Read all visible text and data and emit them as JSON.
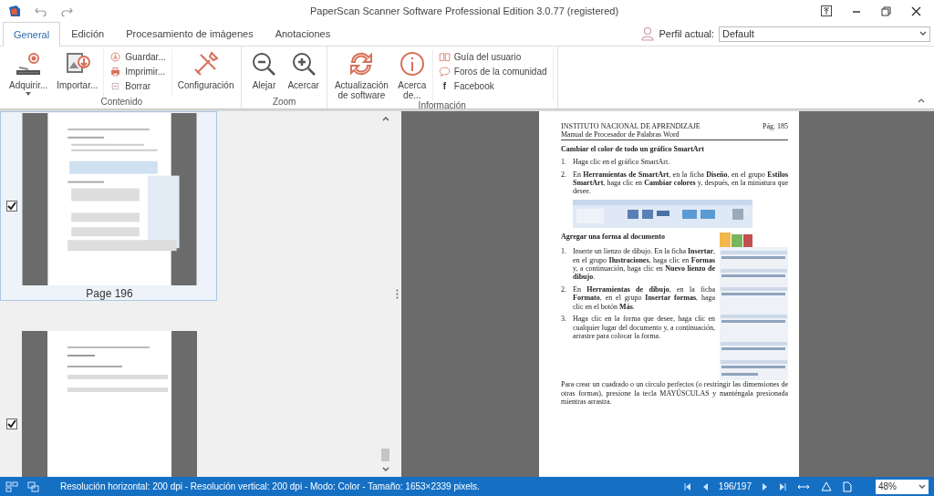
{
  "window": {
    "title": "PaperScan Scanner Software Professional Edition 3.0.77 (registered)"
  },
  "tabs": [
    {
      "label": "General",
      "selected": true
    },
    {
      "label": "Edición",
      "selected": false
    },
    {
      "label": "Procesamiento de imágenes",
      "selected": false
    },
    {
      "label": "Anotaciones",
      "selected": false
    }
  ],
  "profile": {
    "label": "Perfil actual:",
    "value": "Default"
  },
  "ribbon": [
    {
      "label": "Contenido",
      "controls": [
        {
          "kind": "large",
          "label": "Adquirir...",
          "has_menu": true
        },
        {
          "kind": "large",
          "label": "Importar...",
          "has_menu": false
        },
        {
          "kind": "stack",
          "items": [
            {
              "label": "Guardar..."
            },
            {
              "label": "Imprimir..."
            },
            {
              "label": "Borrar"
            }
          ]
        },
        {
          "kind": "large",
          "label": "Configuración",
          "has_menu": false
        }
      ]
    },
    {
      "label": "Zoom",
      "controls": [
        {
          "kind": "large",
          "label": "Alejar",
          "has_menu": false
        },
        {
          "kind": "large",
          "label": "Acercar",
          "has_menu": false
        }
      ]
    },
    {
      "label": "Información",
      "controls": [
        {
          "kind": "large",
          "label": "Actualización\nde software",
          "has_menu": false
        },
        {
          "kind": "large",
          "label": "Acerca\nde...",
          "has_menu": false
        },
        {
          "kind": "stack",
          "items": [
            {
              "label": "Guía del usuario"
            },
            {
              "label": "Foros de la comunidad"
            },
            {
              "label": "Facebook",
              "glyph": "f"
            }
          ]
        }
      ]
    }
  ],
  "thumbnails": [
    {
      "label": "Page 196",
      "checked": true,
      "selected": true
    },
    {
      "checked": true,
      "selected": false
    }
  ],
  "document": {
    "header_left": [
      "INSTITUTO NACIONAL DE APRENDIZAJE",
      "Manual de Procesador de Palabras Word"
    ],
    "header_right": "Pág.  185",
    "sections": [
      {
        "heading": "Cambiar el color de todo un gráfico SmartArt",
        "steps": [
          {
            "number": "1.",
            "text": "Haga clic en el gráfico SmartArt."
          },
          {
            "number": "2.",
            "text": "En **Herramientas de SmartArt**, en la ficha **Diseño**, en el grupo **Estilos SmartArt**, haga clic en **Cambiar colores** y, después, en la miniatura que desee."
          }
        ]
      },
      {
        "heading": "Agregar una forma al documento",
        "steps": [
          {
            "number": "1.",
            "text": "Inserte un lienzo de dibujo. En la ficha **Insertar**, en el grupo **Ilustraciones**, haga clic en **Formas** y, a continuación, haga clic en **Nuevo lienzo de dibujo**."
          },
          {
            "number": "2.",
            "text": "En **Herramientas de dibujo**, en la ficha **Formato**, en el grupo **Insertar formas**, haga clic en el botón **Más**."
          },
          {
            "number": "3.",
            "text": "Haga clic en la forma que desee, haga clic en cualquier lugar del documento y, a continuación, arrastre para colocar la forma."
          }
        ],
        "note": "Para crear un cuadrado o un círculo perfectos (o restringir las dimensiones de otras formas), presione la tecla MAYÚSCULAS y manténgala presionada mientras arrastra."
      }
    ]
  },
  "status_bar": {
    "info": "Resolución horizontal:  200 dpi - Resolución vertical:  200 dpi - Modo: Color - Tamaño: 1653×2339 pixels.",
    "page": "196/197",
    "zoom": "48%"
  }
}
